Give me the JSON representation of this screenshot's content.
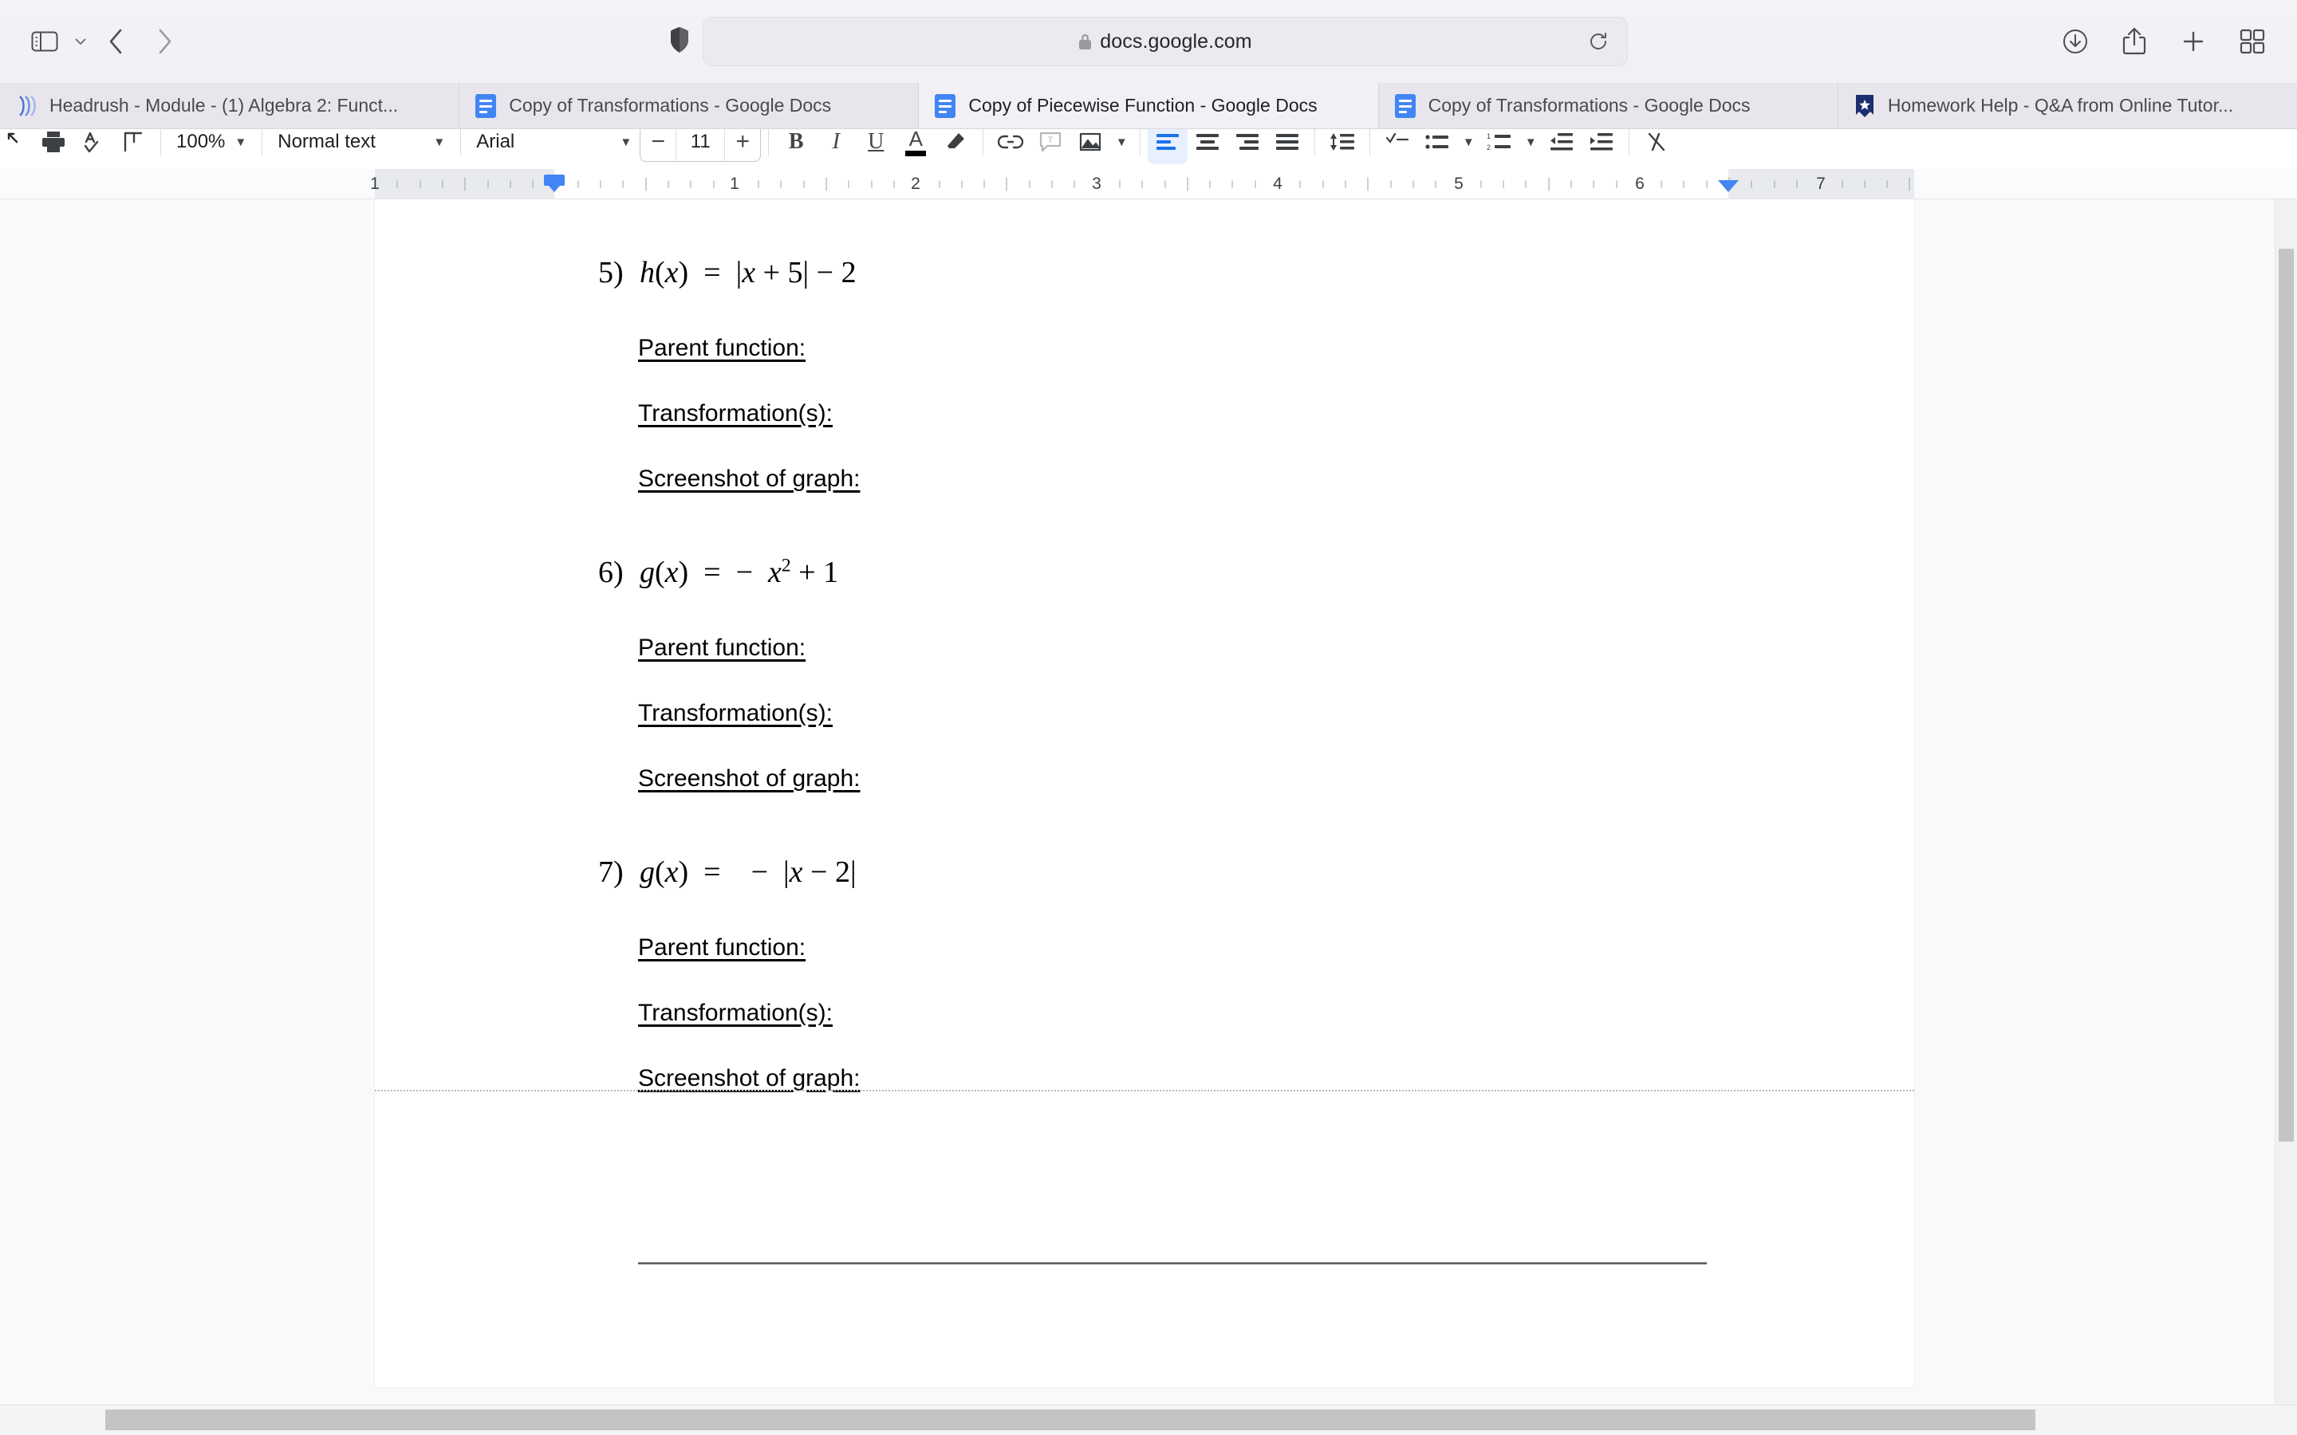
{
  "browser": {
    "name": "Safari",
    "sidebar_toggle": "sidebar-icon",
    "sidebar_caret": "chevron-down-icon",
    "back_label": "Back",
    "forward_label": "Forward",
    "shield_label": "Privacy Report",
    "lock_label": "Secure connection",
    "url": "docs.google.com",
    "reload_label": "Reload",
    "downloads_label": "Downloads",
    "share_label": "Share",
    "new_tab_label": "New Tab",
    "tab_overview_label": "Tab Overview"
  },
  "tabs": [
    {
      "title": "Headrush - Module - (1) Algebra 2: Funct...",
      "favicon": "headrush-icon",
      "active": false
    },
    {
      "title": "Copy of Transformations - Google Docs",
      "favicon": "google-docs-icon",
      "active": false
    },
    {
      "title": "Copy of Piecewise Function - Google Docs",
      "favicon": "google-docs-icon",
      "active": true
    },
    {
      "title": "Copy of Transformations - Google Docs",
      "favicon": "google-docs-icon",
      "active": false
    },
    {
      "title": "Homework Help - Q&A from Online Tutor...",
      "favicon": "homework-help-icon",
      "active": false
    }
  ],
  "toolbar": {
    "undo_label": "Undo",
    "print_label": "Print",
    "spellcheck_label": "Spelling and grammar check",
    "paint_format_label": "Paint format",
    "zoom_value": "100%",
    "style_value": "Normal text",
    "font_value": "Arial",
    "font_size_decrease": "−",
    "font_size_value": "11",
    "font_size_increase": "+",
    "bold_label": "B",
    "italic_label": "I",
    "underline_label": "U",
    "text_color_label": "A",
    "text_color_swatch": "#000000",
    "highlight_label": "Highlight color",
    "link_label": "Insert link",
    "comment_label": "Add comment",
    "image_label": "Insert image",
    "image_caret": "chevron-down-icon",
    "align_left_label": "Left align",
    "align_center_label": "Center align",
    "align_right_label": "Right align",
    "align_justify_label": "Justify",
    "line_spacing_label": "Line & paragraph spacing",
    "checklist_label": "Checklist",
    "bulleted_list_label": "Bulleted list",
    "bulleted_list_caret": "chevron-down-icon",
    "numbered_list_label": "Numbered list",
    "numbered_list_caret": "chevron-down-icon",
    "decrease_indent_label": "Decrease indent",
    "increase_indent_label": "Increase indent",
    "clear_formatting_label": "Clear formatting",
    "active_alignment": "align-left",
    "accent_color": "#1a73e8"
  },
  "ruler": {
    "unit_labels": [
      "1",
      "1",
      "2",
      "3",
      "4",
      "5",
      "6",
      "7"
    ],
    "left_indent_position": "0.5 in",
    "right_indent_position": "6.5 in"
  },
  "document": {
    "questions": [
      {
        "number": "5)",
        "equation_parts": [
          {
            "text": "h",
            "italic": true
          },
          {
            "text": "(",
            "italic": false
          },
          {
            "text": "x",
            "italic": true
          },
          {
            "text": ")  =  |",
            "italic": false
          },
          {
            "text": "x",
            "italic": true
          },
          {
            "text": " + 5| − 2",
            "italic": false
          }
        ],
        "equation_plain": "h(x) = |x + 5| − 2",
        "prompts": [
          "Parent function:",
          "Transformation(s):",
          "Screenshot of graph:"
        ]
      },
      {
        "number": "6)",
        "equation_parts": [
          {
            "text": "g",
            "italic": true
          },
          {
            "text": "(",
            "italic": false
          },
          {
            "text": "x",
            "italic": true
          },
          {
            "text": ")  =  −  ",
            "italic": false
          },
          {
            "text": "x",
            "italic": true,
            "sup": "2"
          },
          {
            "text": " + 1",
            "italic": false
          }
        ],
        "equation_plain": "g(x) = − x² + 1",
        "prompts": [
          "Parent function:",
          "Transformation(s):",
          "Screenshot of graph:"
        ]
      },
      {
        "number": "7)",
        "equation_parts": [
          {
            "text": "g",
            "italic": true
          },
          {
            "text": "(",
            "italic": false
          },
          {
            "text": "x",
            "italic": true
          },
          {
            "text": ")  =    −  |",
            "italic": false
          },
          {
            "text": "x",
            "italic": true
          },
          {
            "text": " − 2|",
            "italic": false
          }
        ],
        "equation_plain": "g(x) =  − |x − 2|",
        "prompts": [
          "Parent function:",
          "Transformation(s):",
          "Screenshot of graph:"
        ]
      }
    ],
    "horizontal_rule": true,
    "page_break_visible": true
  }
}
